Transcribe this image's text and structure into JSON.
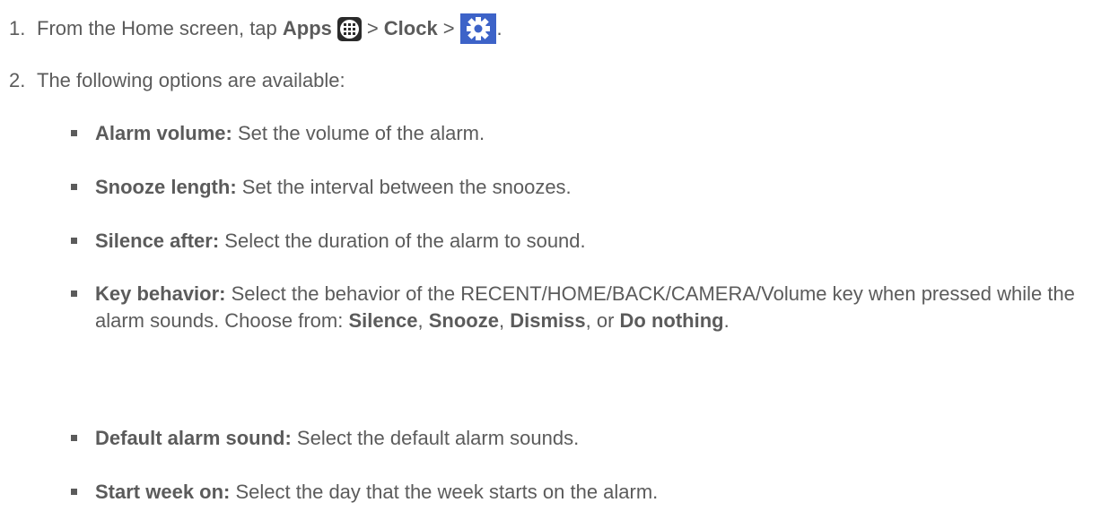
{
  "step1": {
    "number": "1.",
    "text_before": "From the Home screen, tap",
    "apps_label": "Apps",
    "separator": ">",
    "clock_label": "Clock",
    "period": "."
  },
  "step2": {
    "number": "2.",
    "text": "The following options are available:"
  },
  "options": [
    {
      "label": "Alarm volume:",
      "description": " Set the volume of the alarm."
    },
    {
      "label": "Snooze length:",
      "description": " Set the interval between the snoozes."
    },
    {
      "label": "Silence after:",
      "description": " Select the duration of the alarm to sound."
    },
    {
      "label": "Key behavior:",
      "description": " Select the behavior of the RECENT/HOME/BACK/CAMERA/Volume key when pressed while the alarm sounds. Choose from: ",
      "choices": [
        "Silence",
        "Snooze",
        "Dismiss",
        "Do nothing"
      ],
      "choice_sep": ", ",
      "choice_last_sep": ", or ",
      "end": "."
    },
    {
      "label": "Default alarm sound:",
      "description": " Select the default alarm sounds."
    },
    {
      "label": "Start week on:",
      "description": " Select the day that the week starts on the alarm."
    }
  ],
  "icons": {
    "apps": "apps-grid-icon",
    "settings": "gear-icon"
  },
  "colors": {
    "text": "#5b5b5b",
    "gear_background": "#3d63c8",
    "apps_background": "#2b2b2b"
  }
}
